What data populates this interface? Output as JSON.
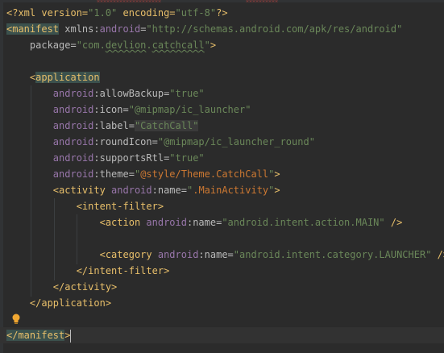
{
  "lines": [
    {
      "tokens": [
        {
          "k": "proc",
          "t": "<?xml version="
        },
        {
          "k": "val",
          "t": "\"1.0\""
        },
        {
          "k": "proc",
          "t": " encoding="
        },
        {
          "k": "val",
          "t": "\"utf-8\""
        },
        {
          "k": "proc",
          "t": "?>"
        }
      ]
    },
    {
      "tokens": [
        {
          "k": "hltag",
          "t": "<manifest"
        },
        {
          "k": "attr",
          "t": " xmlns:"
        },
        {
          "k": "ns",
          "t": "android"
        },
        {
          "k": "attr",
          "t": "="
        },
        {
          "k": "val",
          "t": "\"http://schemas.android.com/apk/res/android\""
        }
      ]
    },
    {
      "tokens": [
        {
          "k": "attr",
          "t": "    package="
        },
        {
          "k": "val",
          "t": "\"com."
        },
        {
          "k": "valsq",
          "t": "devlion"
        },
        {
          "k": "val",
          "t": "."
        },
        {
          "k": "valsq",
          "t": "catchcall"
        },
        {
          "k": "val",
          "t": "\""
        },
        {
          "k": "tag",
          "t": ">"
        }
      ]
    },
    {
      "tokens": []
    },
    {
      "tokens": [
        {
          "k": "tag",
          "t": "    <"
        },
        {
          "k": "tagbg",
          "t": "application"
        }
      ]
    },
    {
      "tokens": [
        {
          "k": "ns",
          "t": "        android"
        },
        {
          "k": "attr",
          "t": ":allowBackup="
        },
        {
          "k": "val",
          "t": "\"true\""
        }
      ]
    },
    {
      "tokens": [
        {
          "k": "ns",
          "t": "        android"
        },
        {
          "k": "attr",
          "t": ":icon="
        },
        {
          "k": "val",
          "t": "\"@mipmap/ic_launcher\""
        }
      ]
    },
    {
      "tokens": [
        {
          "k": "ns",
          "t": "        android"
        },
        {
          "k": "attr",
          "t": ":label="
        },
        {
          "k": "valbg",
          "t": "\"CatchCall\""
        }
      ]
    },
    {
      "tokens": [
        {
          "k": "ns",
          "t": "        android"
        },
        {
          "k": "attr",
          "t": ":roundIcon="
        },
        {
          "k": "val",
          "t": "\"@mipmap/ic_launcher_round\""
        }
      ]
    },
    {
      "tokens": [
        {
          "k": "ns",
          "t": "        android"
        },
        {
          "k": "attr",
          "t": ":supportsRtl="
        },
        {
          "k": "val",
          "t": "\"true\""
        }
      ]
    },
    {
      "tokens": [
        {
          "k": "ns",
          "t": "        android"
        },
        {
          "k": "attr",
          "t": ":theme="
        },
        {
          "k": "val",
          "t": "\""
        },
        {
          "k": "ref",
          "t": "@style/Theme.CatchCall"
        },
        {
          "k": "val",
          "t": "\""
        },
        {
          "k": "tag",
          "t": ">"
        }
      ]
    },
    {
      "tokens": [
        {
          "k": "tag",
          "t": "        <activity "
        },
        {
          "k": "ns",
          "t": "android"
        },
        {
          "k": "attr",
          "t": ":name="
        },
        {
          "k": "val",
          "t": "\""
        },
        {
          "k": "ref",
          "t": ".MainActivity"
        },
        {
          "k": "val",
          "t": "\""
        },
        {
          "k": "tag",
          "t": ">"
        }
      ]
    },
    {
      "tokens": [
        {
          "k": "tag",
          "t": "            <intent-filter>"
        }
      ]
    },
    {
      "tokens": [
        {
          "k": "tag",
          "t": "                <action "
        },
        {
          "k": "ns",
          "t": "android"
        },
        {
          "k": "attr",
          "t": ":name="
        },
        {
          "k": "val",
          "t": "\"android.intent.action.MAIN\""
        },
        {
          "k": "tag",
          "t": " />"
        }
      ]
    },
    {
      "tokens": []
    },
    {
      "tokens": [
        {
          "k": "tag",
          "t": "                <category "
        },
        {
          "k": "ns",
          "t": "android"
        },
        {
          "k": "attr",
          "t": ":name="
        },
        {
          "k": "val",
          "t": "\"android.intent.category.LAUNCHER\""
        },
        {
          "k": "tag",
          "t": " />"
        }
      ]
    },
    {
      "tokens": [
        {
          "k": "tag",
          "t": "            </intent-filter>"
        }
      ]
    },
    {
      "tokens": [
        {
          "k": "tag",
          "t": "        </activity>"
        }
      ]
    },
    {
      "tokens": [
        {
          "k": "tag",
          "t": "    </application>"
        }
      ]
    },
    {
      "tokens": []
    },
    {
      "tokens": [
        {
          "k": "hltag",
          "t": "</manifest"
        },
        {
          "k": "tag",
          "t": ">"
        }
      ]
    }
  ],
  "colors": {
    "background": "#2b2b2b",
    "tag": "#e8bf6a",
    "attribute": "#bababa",
    "namespace": "#9876aa",
    "string": "#6a8759",
    "reference": "#cc7832",
    "caret_line": "#323232"
  },
  "icons": {
    "intention": "lightbulb-icon"
  },
  "caret_line_index": 20
}
